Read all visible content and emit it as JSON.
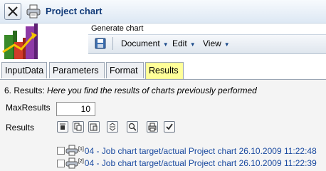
{
  "window": {
    "title": "Project chart",
    "close_icon": "close-icon",
    "print_icon": "printer-icon"
  },
  "generate": {
    "label": "Generate chart",
    "save_icon": "save-icon",
    "menus": [
      {
        "label": "Document"
      },
      {
        "label": "Edit"
      },
      {
        "label": "View"
      }
    ]
  },
  "tabs": [
    {
      "label": "InputData",
      "active": false
    },
    {
      "label": "Parameters",
      "active": false
    },
    {
      "label": "Format",
      "active": false
    },
    {
      "label": "Results",
      "active": true
    }
  ],
  "results": {
    "heading_prefix": "6. Results: ",
    "heading_italic": "Here you find the results of charts previously performed",
    "max_results_label": "MaxResults",
    "max_results_value": "10",
    "results_label": "Results",
    "toolbar_icons": [
      "top-align-icon",
      "copy-icon",
      "paste-icon",
      "expand-collapse-icon",
      "search-icon",
      "print-icon",
      "check-icon"
    ],
    "rows": [
      {
        "index": "[1]",
        "text": "04 - Job chart target/actual Project chart 26.10.2009 11:22:48"
      },
      {
        "index": "[2]",
        "text": "04 - Job chart target/actual Project chart 26.10.2009 11:22:39"
      }
    ]
  },
  "colors": {
    "accent": "#113a78",
    "active_tab": "#ffff99",
    "link": "#1a4aa0"
  }
}
